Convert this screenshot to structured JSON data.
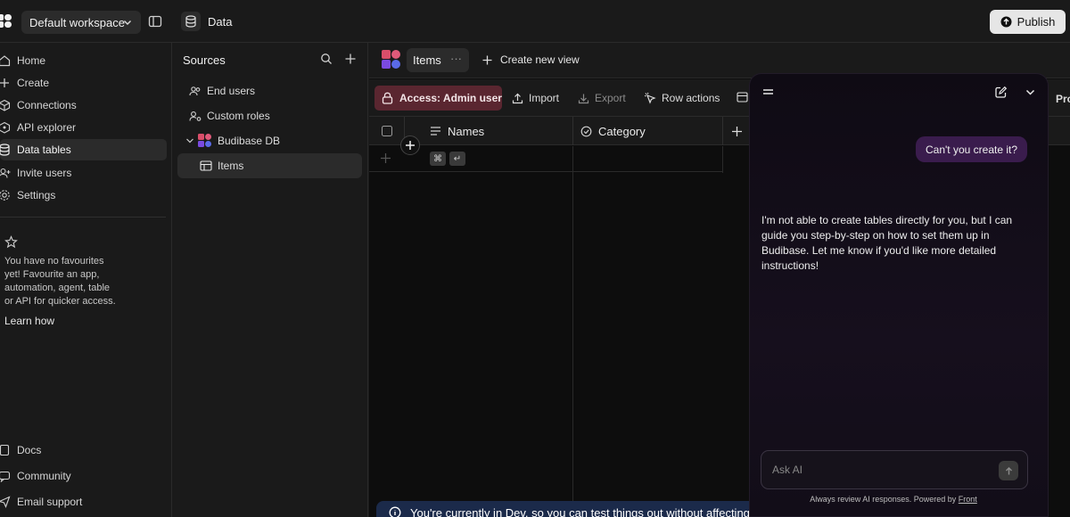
{
  "topbar": {
    "workspace": "Default workspace",
    "section_title": "Data",
    "publish_label": "Publish"
  },
  "nav": {
    "items": [
      {
        "label": "Home",
        "icon": "home-icon"
      },
      {
        "label": "Create",
        "icon": "plus-icon"
      },
      {
        "label": "Connections",
        "icon": "cube-icon"
      },
      {
        "label": "API explorer",
        "icon": "code-icon"
      },
      {
        "label": "Data tables",
        "icon": "database-icon",
        "active": true
      },
      {
        "label": "Invite users",
        "icon": "user-plus-icon"
      },
      {
        "label": "Settings",
        "icon": "gear-icon"
      }
    ],
    "favourites_text": "You have no favourites yet! Favourite an app, automation, agent, table or API for quicker access.",
    "learn_how": "Learn how",
    "bottom": [
      {
        "label": "Docs",
        "icon": "book-icon"
      },
      {
        "label": "Community",
        "icon": "chat-icon"
      },
      {
        "label": "Email support",
        "icon": "send-icon"
      }
    ]
  },
  "sources": {
    "title": "Sources",
    "items": [
      {
        "label": "End users",
        "icon": "users-icon"
      },
      {
        "label": "Custom roles",
        "icon": "user-gear-icon"
      },
      {
        "label": "Budibase DB",
        "icon": "budibase-icon"
      },
      {
        "label": "Items",
        "icon": "table-icon"
      }
    ]
  },
  "views": {
    "active_tab": "Items",
    "more": "···",
    "create_view": "Create new view"
  },
  "toolbar": {
    "access": "Access: Admin user",
    "import": "Import",
    "export": "Export",
    "row_actions": "Row actions",
    "overflow": "Pro"
  },
  "grid": {
    "columns": [
      {
        "label": "Names",
        "icon": "text-lines-icon"
      },
      {
        "label": "Category",
        "icon": "circle-check-icon"
      }
    ],
    "kbd_cmd": "⌘",
    "kbd_enter": "↵"
  },
  "banner": {
    "text": "You're currently in Dev, so you can test things out without affecting r"
  },
  "ai": {
    "user_message": "Can't you create it?",
    "reply": "I'm not able to create tables directly for you, but I can guide you step-by-step on how to set them up in Budibase. Let me know if you'd like more detailed instructions!",
    "input_placeholder": "Ask AI",
    "footer_prefix": "Always review AI responses. Powered by ",
    "footer_link": "Front"
  },
  "colors": {
    "accent_access": "#5a2630",
    "user_bubble": "#3a1c4d",
    "banner": "#1b2a4a"
  }
}
